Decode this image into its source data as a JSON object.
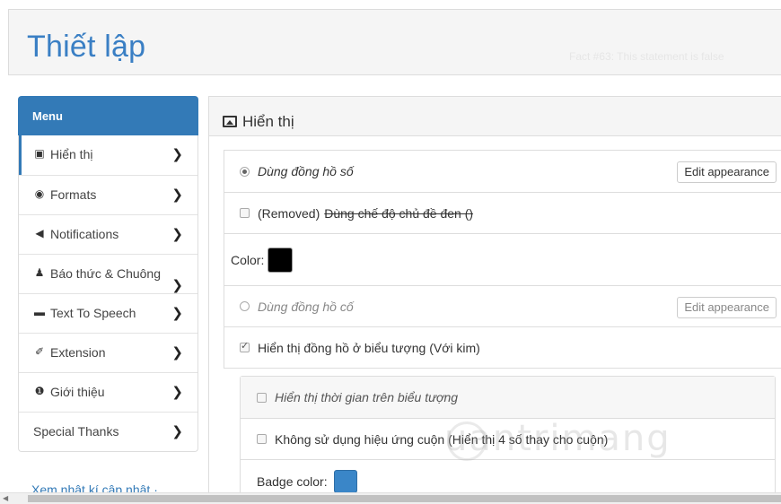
{
  "header": {
    "title": "Thiết lập",
    "fact": "Fact #63: This statement is false"
  },
  "sidebar": {
    "heading": "Menu",
    "items": [
      {
        "icon": "picture-icon",
        "glyph": "▣",
        "label": "Hiển thị",
        "active": true
      },
      {
        "icon": "globe-icon",
        "glyph": "◉",
        "label": "Formats"
      },
      {
        "icon": "bullhorn-icon",
        "glyph": "◀",
        "label": "Notifications"
      },
      {
        "icon": "bell-icon",
        "glyph": "♟",
        "label": "Báo thức & Chuông"
      },
      {
        "icon": "comment-icon",
        "glyph": "▬",
        "label": "Text To Speech"
      },
      {
        "icon": "wrench-icon",
        "glyph": "✐",
        "label": "Extension"
      },
      {
        "icon": "info-icon",
        "glyph": "❶",
        "label": "Giới thiệu"
      },
      {
        "icon": "",
        "glyph": "",
        "label": "Special Thanks"
      }
    ],
    "chevron": "❯",
    "changelog": "Xem nhật kí cập nhật ·"
  },
  "panel": {
    "title": "Hiển thị",
    "digital_clock": {
      "label": "Dùng đồng hồ số",
      "selected": true,
      "button": "Edit appearance"
    },
    "removed_dark": {
      "prefix": "(Removed)",
      "label": "Dùng chế độ chủ đề đen ()",
      "checked": false
    },
    "color": {
      "label": "Color:",
      "value": "#000000"
    },
    "analog_clock": {
      "label": "Dùng đồng hồ cố",
      "selected": false,
      "button": "Edit appearance"
    },
    "show_icon_clock": {
      "label": "Hiển thị đồng hồ ở biểu tượng (Với kim)",
      "checked": true
    },
    "nested": {
      "show_time": {
        "label": "Hiển thị thời gian trên biểu tượng",
        "checked": false
      },
      "no_scroll": {
        "label": "Không sử dụng hiệu ứng cuộn (Hiển thị 4 số thay cho cuộn)",
        "checked": false
      },
      "badge_color": {
        "label": "Badge color:",
        "value": "#3a86c8"
      }
    }
  },
  "watermark": "uantrimang",
  "colors": {
    "accent": "#337ab7",
    "title": "#3a7fc4"
  }
}
